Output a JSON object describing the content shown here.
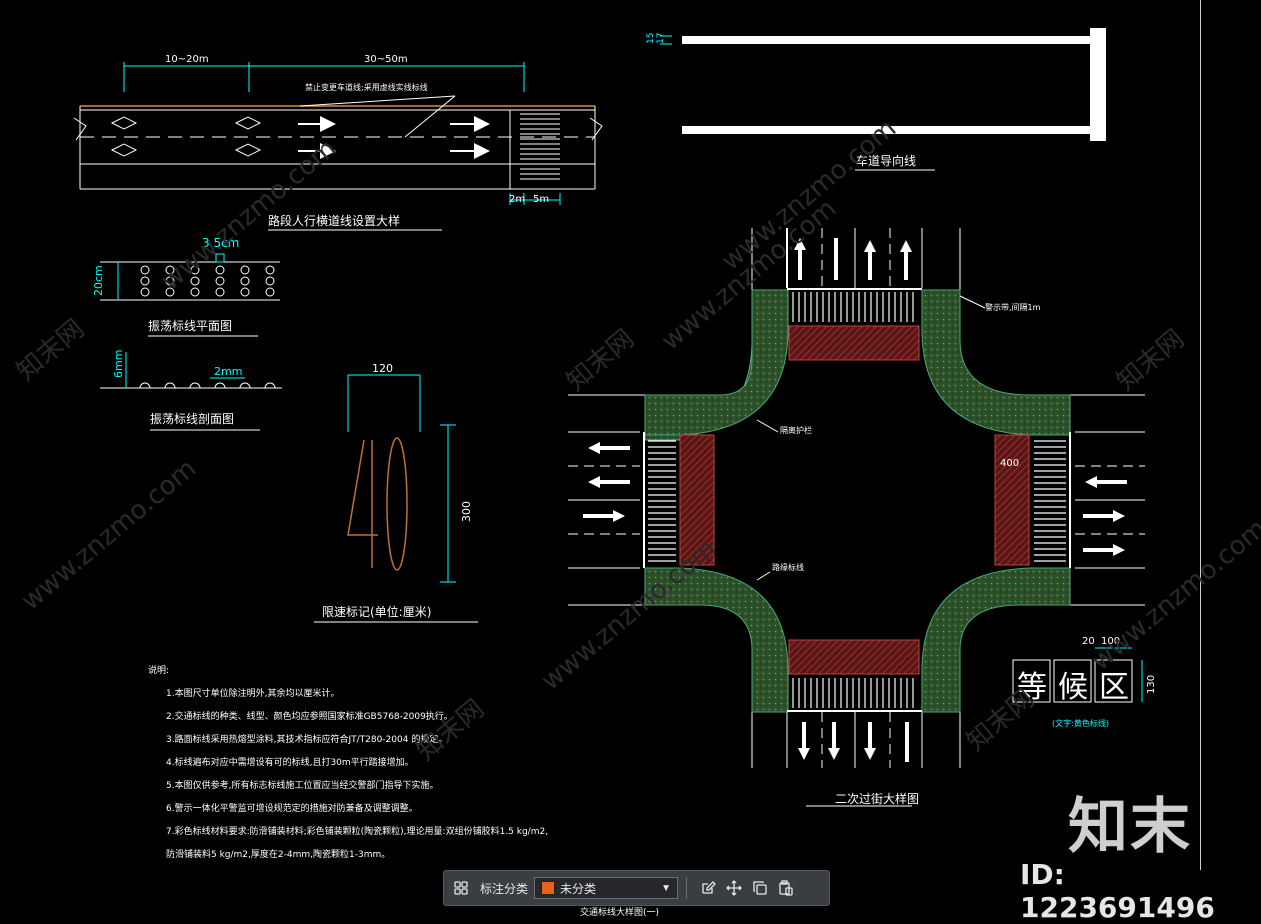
{
  "colors": {
    "background": "#000000",
    "line": "#ffffff",
    "dimension": "#00ffff",
    "greenbelt": "#2f5a2a",
    "crosswalk_red": "#6b1a1a",
    "text_yellow": "#ffff00",
    "speed_number": "#c07030",
    "category_swatch": "#e8621a"
  },
  "drawing1": {
    "title": "路段人行横道线设置大样",
    "dim_left": "10~20m",
    "dim_right": "30~50m",
    "dim_bottom_a": "2m",
    "dim_bottom_b": "5m",
    "callout": "禁止变更车道线;采用虚线实线标线"
  },
  "drawing2": {
    "title": "振荡标线平面图",
    "dim_spacing": "3.5cm",
    "dim_width": "20cm"
  },
  "drawing3": {
    "title": "振荡标线剖面图",
    "dim_height": "6mm",
    "dim_gap": "2mm"
  },
  "drawing4": {
    "title": "限速标记(单位:厘米)",
    "number": "40",
    "dim_width": "120",
    "dim_height": "300"
  },
  "drawing5": {
    "title": "车道导向线",
    "dim_a": "15",
    "dim_b": "17"
  },
  "drawing6": {
    "title": "二次过街大样图",
    "label_greenbelt": "隔离护栏",
    "label_edge": "路缘标线",
    "label_width": "警示带,间隔1m",
    "label_400": "400",
    "label_wait_dims_a": "20",
    "label_wait_dims_b": "100",
    "label_wait_height": "130",
    "wait_chars": [
      "等",
      "候",
      "区"
    ],
    "wait_note": "(文字:黄色标线)"
  },
  "notes": {
    "heading": "说明:",
    "items": [
      "1.本图尺寸单位除注明外,其余均以厘米计。",
      "2.交通标线的种类、线型、颜色均应参照国家标准GB5768-2009执行。",
      "3.路面标线采用热熔型涂料,其技术指标应符合JT/T280-2004 的规定。",
      "4.标线遍布对应中需增设有可的标线,且打30m平行踏接增加。",
      "5.本图仅供参考,所有标志标线施工位置应当经交警部门指导下实施。",
      "6.警示一体化平警监可增设规范定的措施对防兼备及调整调整。",
      "7.彩色标线材料要求:防滑铺装材料;彩色铺装颗粒(陶瓷颗粒),理论用量:双组份铺胶料1.5 kg/m2,",
      "   防滑铺装料5 kg/m2,厚度在2-4mm,陶瓷颗粒1-3mm。"
    ]
  },
  "watermark": {
    "text_cn": "知末网",
    "text_url": "www.znzmo.com",
    "brand": "知末",
    "image_id": "ID: 1223691496"
  },
  "toolbar": {
    "label": "标注分类",
    "selected": "未分类",
    "icons": [
      "grid-icon",
      "edit-icon",
      "move-icon",
      "copy-icon",
      "paste-icon"
    ]
  },
  "bottom_clip": "交通标线大样图(一)"
}
